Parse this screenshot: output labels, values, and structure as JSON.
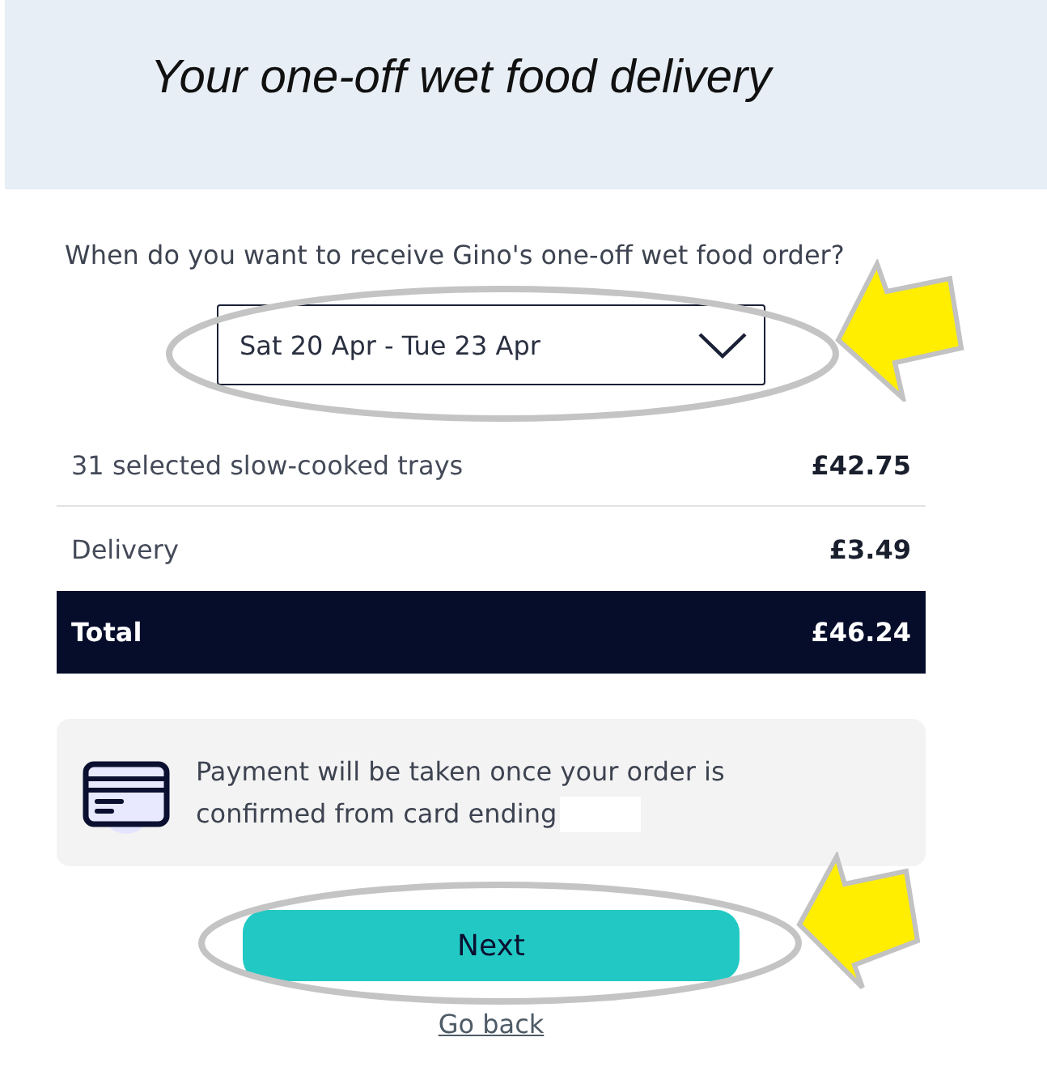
{
  "header": {
    "title": "Your one-off wet food delivery"
  },
  "delivery": {
    "question": "When do you want to receive Gino's one-off wet food order?",
    "date_select": {
      "value": "Sat 20 Apr - Tue 23 Apr",
      "highlighted": true
    }
  },
  "summary": {
    "rows": [
      {
        "kind": "item",
        "label": "31 selected slow-cooked trays",
        "price": "£42.75"
      },
      {
        "kind": "item",
        "label": "Delivery",
        "price": "£3.49"
      },
      {
        "kind": "total",
        "label": "Total",
        "price": "£46.24"
      }
    ]
  },
  "payment_note": {
    "text": "Payment will be taken once your order is confirmed from card ending",
    "card_number_hidden": true
  },
  "actions": {
    "next_button": {
      "label": "Next",
      "highlighted": true
    },
    "back_link": {
      "label": "Go back"
    }
  }
}
